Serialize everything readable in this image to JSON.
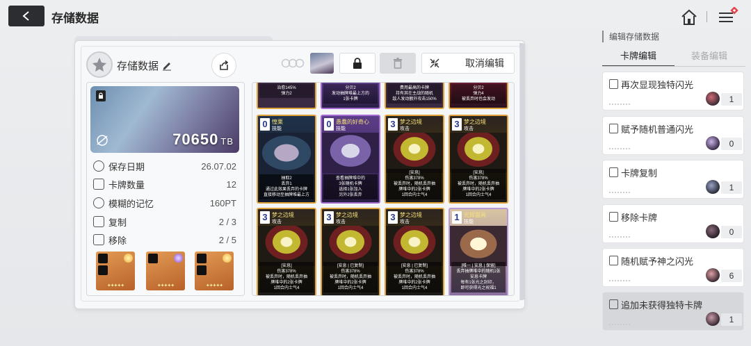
{
  "header": {
    "title": "存储数据"
  },
  "panel": {
    "title": "存储数据",
    "cancel_label": "取消编辑"
  },
  "info": {
    "value": "70650",
    "unit": "TB",
    "stats": [
      {
        "label": "保存日期",
        "value": "26.07.02",
        "icon": "clock-icon"
      },
      {
        "label": "卡牌数量",
        "value": "12",
        "icon": "card-count-icon"
      },
      {
        "label": "模糊的记忆",
        "value": "160PT",
        "icon": "brain-icon"
      },
      {
        "label": "复制",
        "value": "2 / 3",
        "icon": "copy-icon"
      },
      {
        "label": "移除",
        "value": "2 / 5",
        "icon": "remove-icon"
      }
    ]
  },
  "cards": {
    "top": [
      {
        "desc": "治愈145%\n弹力2"
      },
      {
        "desc": "分贝2\n发动抽牌堆最上方的\n1张卡牌"
      },
      {
        "desc": "费用最高的卡牌\n持有其在主战的随机\n敌人发动额外攻击150%"
      },
      {
        "desc": "分贝2\n弹力4\n被丢弃时也会发动"
      }
    ],
    "grid": [
      {
        "cost": "0",
        "name": "惶栗",
        "type": "技能",
        "desc": "抽取2\n丢弃1\n通过此效果丢弃的卡牌\n直接移动至抽牌堆最上方",
        "style": "teal"
      },
      {
        "cost": "0",
        "name": "愚蠢的好奇心",
        "type": "技能",
        "desc": "查看抽牌堆中的\n3张随机卡牌\n选择1张加入\n另外2张丢弃",
        "style": "purple"
      },
      {
        "cost": "3",
        "name": "梦之边境",
        "type": "攻击",
        "desc": "[安息]\n伤害378%\n被丢弃时，随机丢弃抽\n牌堆中的2张卡牌\n1回合内士气4",
        "style": "dream"
      },
      {
        "cost": "3",
        "name": "梦之边境",
        "type": "攻击",
        "desc": "[安息]\n伤害378%\n被丢弃时，随机丢弃抽\n牌堆中的2张卡牌\n1回合内士气4",
        "style": "dream"
      },
      {
        "cost": "3",
        "name": "梦之边境",
        "type": "攻击",
        "desc": "[安息]\n伤害378%\n被丢弃时，随机丢弃抽\n牌堆中的2张卡牌\n1回合内士气4",
        "style": "dream"
      },
      {
        "cost": "3",
        "name": "梦之边境",
        "type": "攻击",
        "desc": "[安息 | 已复制]\n伤害378%\n被丢弃时，随机丢弃抽\n牌堆中的2张卡牌\n1回合内士气4",
        "style": "dream"
      },
      {
        "cost": "3",
        "name": "梦之边境",
        "type": "攻击",
        "desc": "[安息 | 已复制]\n伤害378%\n被丢弃时，随机丢弃抽\n牌堆中的2张卡牌\n1回合内士气4",
        "style": "dream"
      },
      {
        "cost": "1",
        "name": "光辉面具",
        "type": "技能",
        "desc": "[唯一 | 安息 | 保留]\n丢弃抽牌堆中的随机1张\n安息卡牌\n每有1张光之封印，\n即可获得光之祝福1",
        "style": "light"
      }
    ]
  },
  "sidebar": {
    "title": "编辑存储数据",
    "tabs": [
      {
        "label": "卡牌编辑",
        "active": true
      },
      {
        "label": "装备编辑",
        "active": false
      }
    ],
    "ops": [
      {
        "label": "再次显现独特闪光",
        "count": "1"
      },
      {
        "label": "赋予随机普通闪光",
        "count": "0"
      },
      {
        "label": "卡牌复制",
        "count": "1"
      },
      {
        "label": "移除卡牌",
        "count": "0"
      },
      {
        "label": "随机赋予神之闪光",
        "count": "6"
      },
      {
        "label": "追加未获得独特卡牌",
        "count": "1"
      }
    ]
  },
  "colors": {
    "accent": "#2b2d31",
    "card_border_gold": "#e0a33a",
    "badge_red": "#e8414b"
  }
}
